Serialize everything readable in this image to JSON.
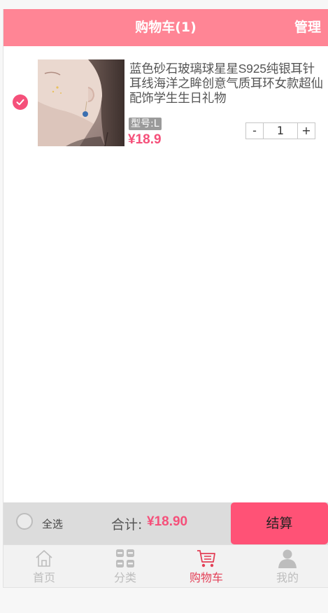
{
  "header": {
    "title": "购物车(1)",
    "manage_label": "管理"
  },
  "cart": {
    "items": [
      {
        "title": "蓝色砂石玻璃球星星S925纯银耳针耳线海洋之眸创意气质耳环女款超仙配饰学生生日礼物",
        "spec": "型号:L",
        "price": "¥18.9",
        "quantity": "1",
        "selected": true,
        "minus_label": "-",
        "plus_label": "+"
      }
    ]
  },
  "checkout": {
    "select_all_label": "全选",
    "total_label": "合计:",
    "total_value": "¥18.90",
    "checkout_label": "结算"
  },
  "tabbar": {
    "tabs": [
      {
        "label": "首页",
        "icon": "home-icon",
        "active": false
      },
      {
        "label": "分类",
        "icon": "category-icon",
        "active": false
      },
      {
        "label": "购物车",
        "icon": "cart-icon",
        "active": true
      },
      {
        "label": "我的",
        "icon": "user-icon",
        "active": false
      }
    ]
  },
  "colors": {
    "header_bg": "#ff8595",
    "accent": "#f5507a",
    "checkout_button": "#ff5276",
    "active_tab": "#e33f56",
    "inactive_tab": "#bdbdbd"
  }
}
